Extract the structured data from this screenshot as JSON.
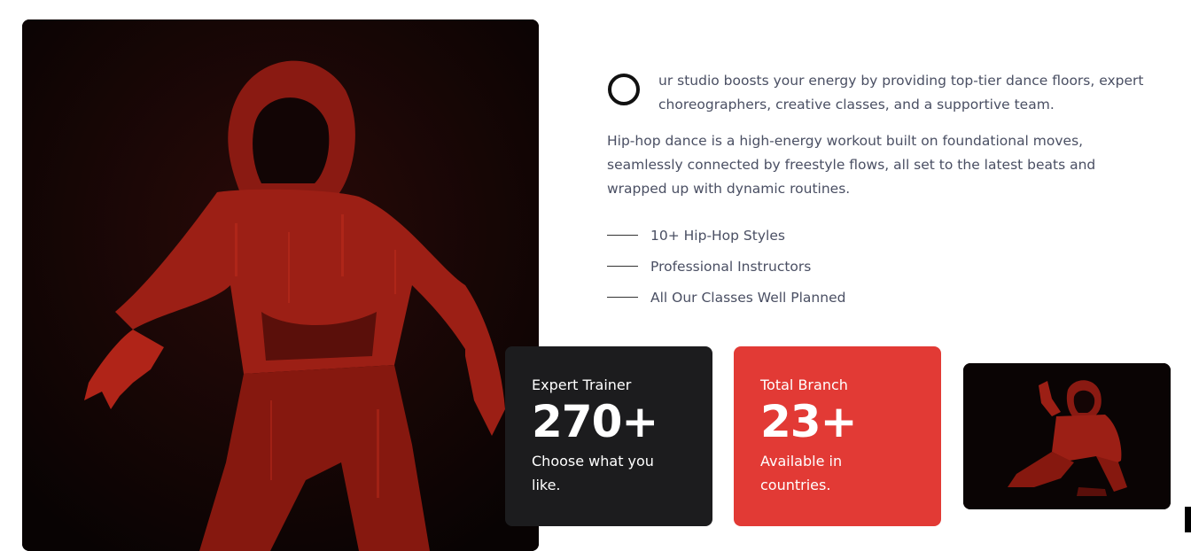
{
  "intro": {
    "text": "ur studio boosts your energy by providing top-tier dance floors, expert choreographers, creative classes, and a supportive team."
  },
  "description": "Hip-hop dance is a high-energy workout built on foundational moves, seamlessly connected by freestyle flows, all set to the latest beats and wrapped up with dynamic routines.",
  "features": [
    "10+ Hip-Hop Styles",
    "Professional Instructors",
    "All Our Classes Well Planned"
  ],
  "stats": {
    "trainer": {
      "label": "Expert Trainer",
      "value": "270+",
      "desc": "Choose what you like."
    },
    "branch": {
      "label": "Total Branch",
      "value": "23+",
      "desc": "Available in countries."
    }
  },
  "colors": {
    "accent": "#e23a35",
    "dark_card": "#1c1c1e",
    "text": "#4a4f63"
  },
  "images": {
    "hero": "hooded-dancer-red-artwork",
    "thumb": "kneeling-hooded-dancer-red-artwork"
  }
}
